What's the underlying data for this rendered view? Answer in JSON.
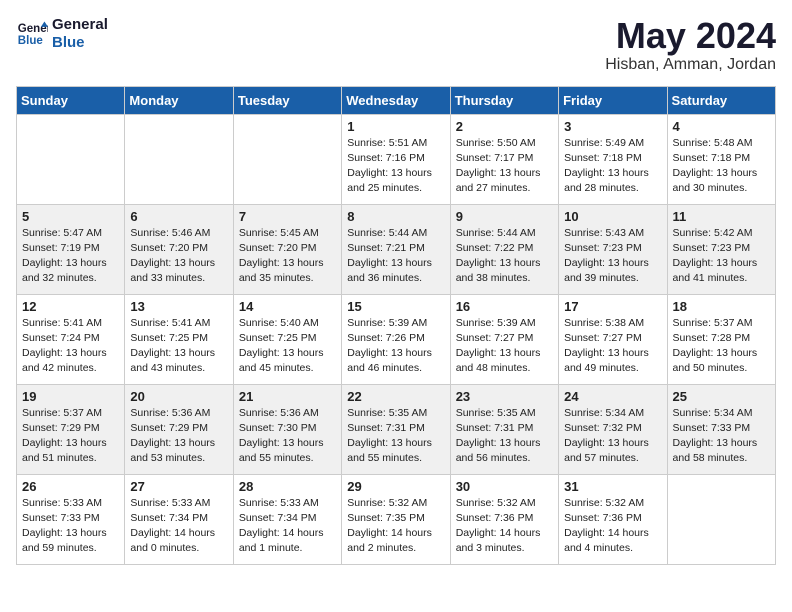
{
  "logo": {
    "line1": "General",
    "line2": "Blue"
  },
  "title": "May 2024",
  "location": "Hisban, Amman, Jordan",
  "weekdays": [
    "Sunday",
    "Monday",
    "Tuesday",
    "Wednesday",
    "Thursday",
    "Friday",
    "Saturday"
  ],
  "weeks": [
    [
      {
        "day": "",
        "info": ""
      },
      {
        "day": "",
        "info": ""
      },
      {
        "day": "",
        "info": ""
      },
      {
        "day": "1",
        "info": "Sunrise: 5:51 AM\nSunset: 7:16 PM\nDaylight: 13 hours\nand 25 minutes."
      },
      {
        "day": "2",
        "info": "Sunrise: 5:50 AM\nSunset: 7:17 PM\nDaylight: 13 hours\nand 27 minutes."
      },
      {
        "day": "3",
        "info": "Sunrise: 5:49 AM\nSunset: 7:18 PM\nDaylight: 13 hours\nand 28 minutes."
      },
      {
        "day": "4",
        "info": "Sunrise: 5:48 AM\nSunset: 7:18 PM\nDaylight: 13 hours\nand 30 minutes."
      }
    ],
    [
      {
        "day": "5",
        "info": "Sunrise: 5:47 AM\nSunset: 7:19 PM\nDaylight: 13 hours\nand 32 minutes."
      },
      {
        "day": "6",
        "info": "Sunrise: 5:46 AM\nSunset: 7:20 PM\nDaylight: 13 hours\nand 33 minutes."
      },
      {
        "day": "7",
        "info": "Sunrise: 5:45 AM\nSunset: 7:20 PM\nDaylight: 13 hours\nand 35 minutes."
      },
      {
        "day": "8",
        "info": "Sunrise: 5:44 AM\nSunset: 7:21 PM\nDaylight: 13 hours\nand 36 minutes."
      },
      {
        "day": "9",
        "info": "Sunrise: 5:44 AM\nSunset: 7:22 PM\nDaylight: 13 hours\nand 38 minutes."
      },
      {
        "day": "10",
        "info": "Sunrise: 5:43 AM\nSunset: 7:23 PM\nDaylight: 13 hours\nand 39 minutes."
      },
      {
        "day": "11",
        "info": "Sunrise: 5:42 AM\nSunset: 7:23 PM\nDaylight: 13 hours\nand 41 minutes."
      }
    ],
    [
      {
        "day": "12",
        "info": "Sunrise: 5:41 AM\nSunset: 7:24 PM\nDaylight: 13 hours\nand 42 minutes."
      },
      {
        "day": "13",
        "info": "Sunrise: 5:41 AM\nSunset: 7:25 PM\nDaylight: 13 hours\nand 43 minutes."
      },
      {
        "day": "14",
        "info": "Sunrise: 5:40 AM\nSunset: 7:25 PM\nDaylight: 13 hours\nand 45 minutes."
      },
      {
        "day": "15",
        "info": "Sunrise: 5:39 AM\nSunset: 7:26 PM\nDaylight: 13 hours\nand 46 minutes."
      },
      {
        "day": "16",
        "info": "Sunrise: 5:39 AM\nSunset: 7:27 PM\nDaylight: 13 hours\nand 48 minutes."
      },
      {
        "day": "17",
        "info": "Sunrise: 5:38 AM\nSunset: 7:27 PM\nDaylight: 13 hours\nand 49 minutes."
      },
      {
        "day": "18",
        "info": "Sunrise: 5:37 AM\nSunset: 7:28 PM\nDaylight: 13 hours\nand 50 minutes."
      }
    ],
    [
      {
        "day": "19",
        "info": "Sunrise: 5:37 AM\nSunset: 7:29 PM\nDaylight: 13 hours\nand 51 minutes."
      },
      {
        "day": "20",
        "info": "Sunrise: 5:36 AM\nSunset: 7:29 PM\nDaylight: 13 hours\nand 53 minutes."
      },
      {
        "day": "21",
        "info": "Sunrise: 5:36 AM\nSunset: 7:30 PM\nDaylight: 13 hours\nand 55 minutes."
      },
      {
        "day": "22",
        "info": "Sunrise: 5:35 AM\nSunset: 7:31 PM\nDaylight: 13 hours\nand 55 minutes."
      },
      {
        "day": "23",
        "info": "Sunrise: 5:35 AM\nSunset: 7:31 PM\nDaylight: 13 hours\nand 56 minutes."
      },
      {
        "day": "24",
        "info": "Sunrise: 5:34 AM\nSunset: 7:32 PM\nDaylight: 13 hours\nand 57 minutes."
      },
      {
        "day": "25",
        "info": "Sunrise: 5:34 AM\nSunset: 7:33 PM\nDaylight: 13 hours\nand 58 minutes."
      }
    ],
    [
      {
        "day": "26",
        "info": "Sunrise: 5:33 AM\nSunset: 7:33 PM\nDaylight: 13 hours\nand 59 minutes."
      },
      {
        "day": "27",
        "info": "Sunrise: 5:33 AM\nSunset: 7:34 PM\nDaylight: 14 hours\nand 0 minutes."
      },
      {
        "day": "28",
        "info": "Sunrise: 5:33 AM\nSunset: 7:34 PM\nDaylight: 14 hours\nand 1 minute."
      },
      {
        "day": "29",
        "info": "Sunrise: 5:32 AM\nSunset: 7:35 PM\nDaylight: 14 hours\nand 2 minutes."
      },
      {
        "day": "30",
        "info": "Sunrise: 5:32 AM\nSunset: 7:36 PM\nDaylight: 14 hours\nand 3 minutes."
      },
      {
        "day": "31",
        "info": "Sunrise: 5:32 AM\nSunset: 7:36 PM\nDaylight: 14 hours\nand 4 minutes."
      },
      {
        "day": "",
        "info": ""
      }
    ]
  ]
}
